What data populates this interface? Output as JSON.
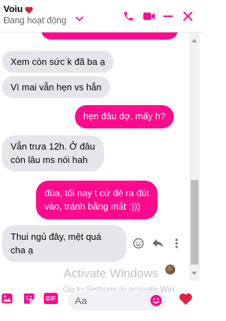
{
  "header": {
    "name": "Voiu",
    "status": "Đang hoạt động"
  },
  "messages": [
    {
      "side": "in",
      "text": "Xem còn sức k đã ba ạ"
    },
    {
      "side": "in",
      "text": "Vì mai vẫn hẹn vs hắn"
    },
    {
      "side": "out",
      "text": "hẹn đâu dợ, mấy h?"
    },
    {
      "side": "in",
      "lines": [
        "Vẫn trưa 12h. Ở đâu",
        "còn lâu ms nói hah"
      ]
    },
    {
      "side": "out",
      "lines": [
        "đùa, tối nay t cứ đè ra đút",
        "vào, tránh bằng mắt :)))"
      ]
    },
    {
      "side": "in",
      "lines": [
        "Thui ngủ đây, mệt quá",
        "cha ạ"
      ]
    }
  ],
  "watermark": {
    "line1": "Activate Windows",
    "line2": "Go to Settings to activate Win"
  },
  "composer": {
    "placeholder": "Aa",
    "gif_label": "GIF"
  },
  "colors": {
    "accent": "#ff0a8c",
    "incoming_bubble": "#e4e6eb"
  },
  "icons": [
    "heart-icon",
    "chevron-down-icon",
    "phone-icon",
    "video-icon",
    "minimize-icon",
    "close-icon",
    "react-icon",
    "reply-icon",
    "more-icon",
    "image-icon",
    "sticker-icon",
    "gif-icon",
    "emoji-icon",
    "heart-icon"
  ]
}
